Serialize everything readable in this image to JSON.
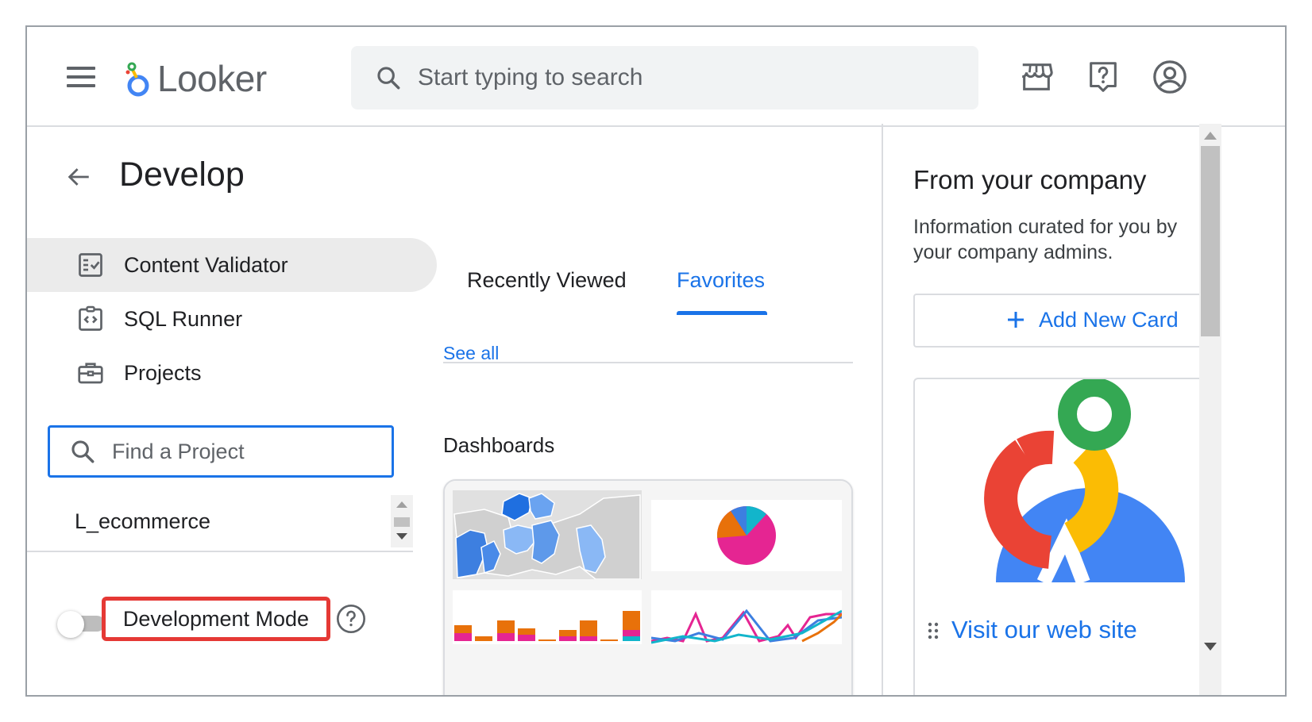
{
  "header": {
    "app_name": "Looker",
    "search_placeholder": "Start typing to search"
  },
  "leftnav": {
    "title": "Develop",
    "items": [
      {
        "label": "Content Validator",
        "icon": "content-validator-icon"
      },
      {
        "label": "SQL Runner",
        "icon": "sql-runner-icon"
      },
      {
        "label": "Projects",
        "icon": "projects-icon"
      }
    ],
    "find_placeholder": "Find a Project",
    "projects": [
      "L_ecommerce"
    ],
    "dev_mode_label": "Development Mode"
  },
  "center": {
    "tabs": [
      "Recently Viewed",
      "Favorites"
    ],
    "see_all": "See all",
    "dashboards_heading": "Dashboards"
  },
  "rightpanel": {
    "title": "From your company",
    "description": "Information curated for you by your company admins.",
    "add_card_label": "Add New Card",
    "visit_link": "Visit our web site"
  },
  "colors": {
    "accent": "#1a73e8",
    "highlight_box": "#e53935"
  }
}
